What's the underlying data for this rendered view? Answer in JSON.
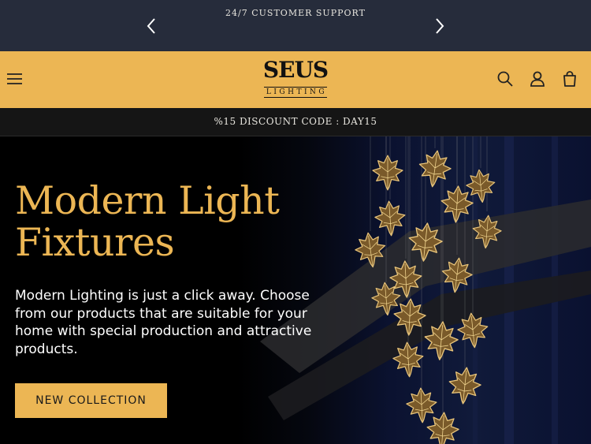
{
  "announcement": {
    "text": "24/7 CUSTOMER SUPPORT"
  },
  "header": {
    "logo_main": "SEUS",
    "logo_sub": "LIGHTING"
  },
  "promo": {
    "text": "%15 DISCOUNT CODE : DAY15"
  },
  "hero": {
    "title_line1": "Modern Light",
    "title_line2": "Fixtures",
    "description": "Modern Lighting is just a click away. Choose from our products that are suitable for your home with special production and attractive products.",
    "cta_label": "NEW COLLECTION"
  },
  "icons": [
    "chevron-left-icon",
    "chevron-right-icon",
    "hamburger-menu-icon",
    "search-icon",
    "account-icon",
    "cart-icon"
  ],
  "colors": {
    "announcement_bg": "#262c3b",
    "header_bg": "#ecb654",
    "promo_bg": "#151515",
    "accent": "#ecb654",
    "hero_bg": "#000000"
  }
}
